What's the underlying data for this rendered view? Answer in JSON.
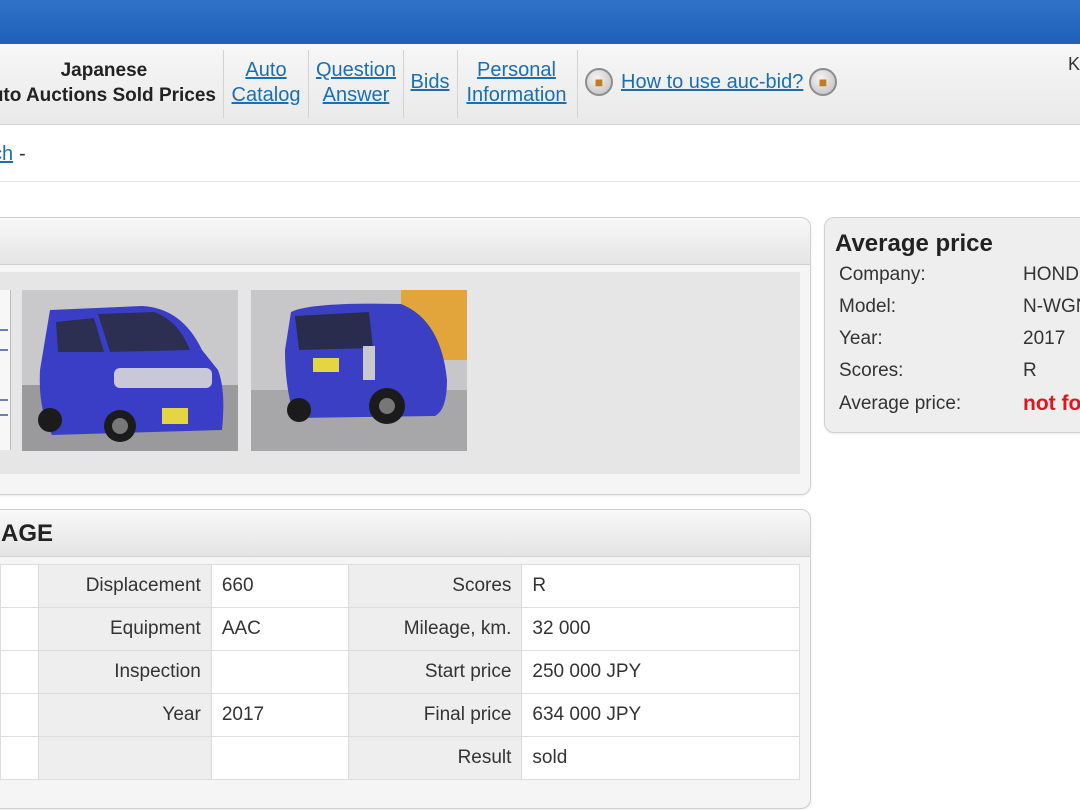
{
  "nav": {
    "title_line1": "Japanese",
    "title_line2": "uto Auctions Sold Prices",
    "links": [
      {
        "line1": "Auto",
        "line2": "Catalog"
      },
      {
        "line1": "Question",
        "line2": "Answer"
      },
      {
        "line1": "Bids",
        "line2": ""
      },
      {
        "line1": "Personal",
        "line2": "Information"
      }
    ],
    "help_link": "How to use auc-bid?",
    "right_letter": "K"
  },
  "breadcrumb": {
    "link": "ch",
    "separator": "-"
  },
  "lot_panel": {
    "title_fragment": ""
  },
  "mileage_panel": {
    "title_fragment": "AGE",
    "rows": [
      {
        "label1": "Displacement",
        "value1": "660",
        "label2": "Scores",
        "value2": "R"
      },
      {
        "label1": "Equipment",
        "value1": "AAC",
        "label2": "Mileage, km.",
        "value2": "32 000"
      },
      {
        "label1": "Inspection",
        "value1": "",
        "label2": "Start price",
        "value2": "250 000 JPY"
      },
      {
        "label1": "Year",
        "value1": "2017",
        "label2": "Final price",
        "value2": "634 000 JPY"
      },
      {
        "label1": "",
        "value1": "",
        "label2": "Result",
        "value2": "sold"
      }
    ]
  },
  "average_price": {
    "title": "Average price",
    "rows": [
      {
        "label": "Company:",
        "value": "HOND"
      },
      {
        "label": "Model:",
        "value": "N-WGN"
      },
      {
        "label": "Year:",
        "value": "2017"
      },
      {
        "label": "Scores:",
        "value": "R"
      },
      {
        "label": "Average price:",
        "value": "not fo"
      }
    ]
  },
  "colors": {
    "header_blue": "#2467bf",
    "link_blue": "#1a6fb0",
    "alert_red": "#e0141e",
    "car_blue": "#3b3fc4"
  }
}
